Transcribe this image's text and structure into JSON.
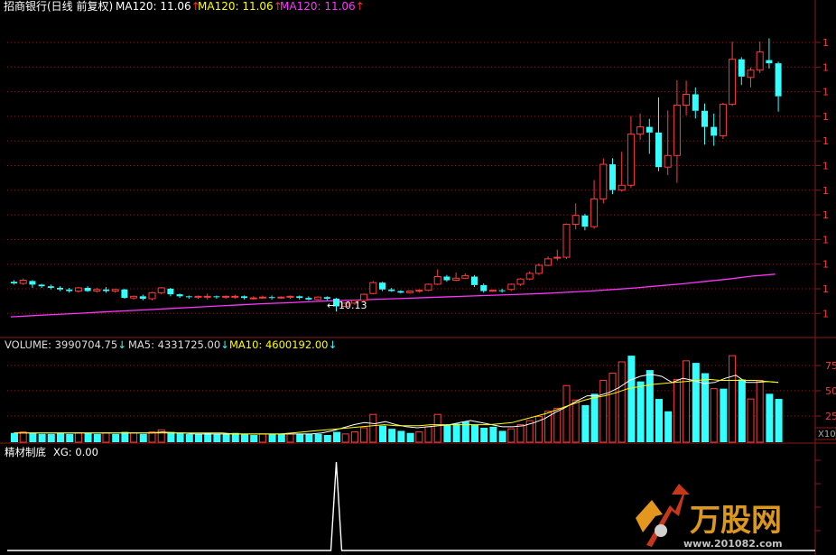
{
  "header": {
    "title": "招商银行(日线 前复权)",
    "ma_items": [
      {
        "text": "MA120: 11.06",
        "arrow": "↑",
        "color": "#ffffff",
        "arrow_color": "#ff3333"
      },
      {
        "text": "MA120: 11.06",
        "arrow": "↑",
        "color": "#ffff00",
        "arrow_color": "#ff3333"
      },
      {
        "text": "MA120: 11.06",
        "arrow": "↑",
        "color": "#ff33ff",
        "arrow_color": "#ff3333"
      }
    ]
  },
  "volume_header": {
    "items": [
      {
        "text": "VOLUME: 3990704.75",
        "arrow": "↓",
        "color": "#dddddd",
        "arrow_color": "#33ffff"
      },
      {
        "text": "MA5: 4331725.00",
        "arrow": "↓",
        "color": "#dddddd",
        "arrow_color": "#33ffff"
      },
      {
        "text": "MA10: 4600192.00",
        "arrow": "↓",
        "color": "#ffff00",
        "arrow_color": "#33ffff"
      }
    ]
  },
  "indicator_header": {
    "name": "精材制底",
    "value": "XG: 0.00"
  },
  "volume_axis": {
    "ticks": [
      "75",
      "50",
      "25"
    ],
    "unit": "X10"
  },
  "watermark": {
    "brand": "万股网",
    "url": "www.201082.com"
  },
  "colors": {
    "up": "#ff3b3b",
    "down": "#33ffff",
    "ma_line": "#ff33ff",
    "vol_ma5": "#ffffff",
    "vol_ma10": "#ffff00",
    "grid": "#8b1a1a",
    "signal": "#ffffff"
  },
  "chart_data": [
    {
      "type": "candlestick",
      "title": "招商银行(日线 前复权)",
      "low_marker": "10.13",
      "ylim": [
        9.8,
        17.2
      ],
      "candles": [
        [
          10.87,
          10.83,
          10.91,
          10.8
        ],
        [
          10.83,
          10.91,
          10.95,
          10.79
        ],
        [
          10.89,
          10.8,
          10.91,
          10.72
        ],
        [
          10.8,
          10.76,
          10.82,
          10.72
        ],
        [
          10.76,
          10.72,
          10.8,
          10.68
        ],
        [
          10.72,
          10.68,
          10.76,
          10.64
        ],
        [
          10.68,
          10.64,
          10.72,
          10.6
        ],
        [
          10.64,
          10.72,
          10.74,
          10.6
        ],
        [
          10.72,
          10.64,
          10.76,
          10.62
        ],
        [
          10.64,
          10.68,
          10.72,
          10.6
        ],
        [
          10.68,
          10.64,
          10.74,
          10.6
        ],
        [
          10.64,
          10.68,
          10.7,
          10.6
        ],
        [
          10.68,
          10.47,
          10.7,
          10.45
        ],
        [
          10.47,
          10.51,
          10.53,
          10.43
        ],
        [
          10.51,
          10.45,
          10.55,
          10.41
        ],
        [
          10.45,
          10.6,
          10.62,
          10.41
        ],
        [
          10.6,
          10.72,
          10.74,
          10.56
        ],
        [
          10.7,
          10.56,
          10.72,
          10.51
        ],
        [
          10.56,
          10.51,
          10.58,
          10.47
        ],
        [
          10.51,
          10.49,
          10.53,
          10.45
        ],
        [
          10.49,
          10.51,
          10.53,
          10.45
        ],
        [
          10.51,
          10.51,
          10.58,
          10.43
        ],
        [
          10.51,
          10.49,
          10.53,
          10.45
        ],
        [
          10.49,
          10.51,
          10.53,
          10.45
        ],
        [
          10.51,
          10.51,
          10.55,
          10.45
        ],
        [
          10.51,
          10.47,
          10.53,
          10.43
        ],
        [
          10.47,
          10.47,
          10.51,
          10.43
        ],
        [
          10.47,
          10.49,
          10.53,
          10.45
        ],
        [
          10.49,
          10.47,
          10.53,
          10.43
        ],
        [
          10.47,
          10.49,
          10.51,
          10.45
        ],
        [
          10.49,
          10.51,
          10.53,
          10.45
        ],
        [
          10.51,
          10.47,
          10.53,
          10.43
        ],
        [
          10.47,
          10.43,
          10.51,
          10.41
        ],
        [
          10.43,
          10.49,
          10.51,
          10.41
        ],
        [
          10.49,
          10.45,
          10.51,
          10.41
        ],
        [
          10.45,
          10.26,
          10.47,
          10.13
        ],
        [
          10.26,
          10.34,
          10.36,
          10.24
        ],
        [
          10.34,
          10.41,
          10.43,
          10.3
        ],
        [
          10.41,
          10.56,
          10.58,
          10.38
        ],
        [
          10.58,
          10.85,
          10.89,
          10.56
        ],
        [
          10.85,
          10.68,
          10.87,
          10.64
        ],
        [
          10.68,
          10.64,
          10.72,
          10.62
        ],
        [
          10.64,
          10.6,
          10.66,
          10.58
        ],
        [
          10.6,
          10.64,
          10.66,
          10.58
        ],
        [
          10.64,
          10.66,
          10.68,
          10.6
        ],
        [
          10.66,
          10.81,
          10.83,
          10.64
        ],
        [
          10.81,
          11.0,
          11.18,
          10.79
        ],
        [
          11.0,
          10.91,
          11.04,
          10.87
        ],
        [
          10.91,
          10.96,
          11.1,
          10.89
        ],
        [
          10.96,
          11.02,
          11.08,
          10.94
        ],
        [
          11.0,
          10.79,
          11.04,
          10.74
        ],
        [
          10.79,
          10.64,
          10.83,
          10.6
        ],
        [
          10.64,
          10.66,
          10.68,
          10.62
        ],
        [
          10.66,
          10.64,
          10.7,
          10.6
        ],
        [
          10.68,
          10.81,
          10.83,
          10.64
        ],
        [
          10.81,
          10.94,
          10.96,
          10.77
        ],
        [
          10.94,
          11.08,
          11.13,
          10.91
        ],
        [
          11.08,
          11.28,
          11.33,
          11.04
        ],
        [
          11.28,
          11.44,
          11.5,
          11.26
        ],
        [
          11.48,
          11.48,
          11.67,
          11.4
        ],
        [
          11.48,
          12.3,
          12.32,
          11.44
        ],
        [
          12.3,
          12.52,
          12.82,
          12.17
        ],
        [
          12.52,
          12.24,
          12.56,
          12.15
        ],
        [
          12.24,
          12.93,
          13.4,
          12.19
        ],
        [
          12.93,
          13.79,
          13.94,
          12.82
        ],
        [
          13.79,
          13.15,
          13.94,
          13.05
        ],
        [
          13.15,
          13.27,
          14.1,
          13.11
        ],
        [
          13.27,
          14.54,
          14.99,
          13.2
        ],
        [
          14.54,
          14.72,
          15.05,
          14.4
        ],
        [
          14.72,
          14.58,
          14.92,
          14.05
        ],
        [
          14.58,
          13.72,
          15.45,
          13.62
        ],
        [
          13.72,
          14.01,
          15.13,
          13.52
        ],
        [
          14.01,
          15.26,
          15.88,
          13.33
        ],
        [
          15.26,
          15.53,
          15.87,
          15.01
        ],
        [
          15.53,
          15.12,
          15.7,
          14.93
        ],
        [
          15.12,
          14.72,
          15.3,
          14.28
        ],
        [
          14.72,
          14.5,
          15.05,
          14.25
        ],
        [
          14.5,
          15.28,
          15.32,
          14.42
        ],
        [
          15.28,
          16.4,
          16.84,
          15.24
        ],
        [
          16.4,
          15.97,
          16.45,
          15.76
        ],
        [
          15.95,
          16.13,
          16.2,
          15.7
        ],
        [
          16.13,
          16.58,
          16.84,
          16.06
        ],
        [
          16.38,
          16.3,
          16.92,
          16.17
        ],
        [
          16.3,
          15.48,
          16.34,
          15.1
        ]
      ],
      "ma120": [
        10.0,
        10.03,
        10.06,
        10.09,
        10.12,
        10.15,
        10.18,
        10.21,
        10.24,
        10.27,
        10.3,
        10.33,
        10.35,
        10.38,
        10.4,
        10.42,
        10.44,
        10.46,
        10.48,
        10.5,
        10.52,
        10.54,
        10.56,
        10.58,
        10.61,
        10.64,
        10.68,
        10.72,
        10.77,
        10.82,
        10.88,
        10.94,
        11.01,
        11.06
      ]
    },
    {
      "type": "bar",
      "title": "VOLUME",
      "unit": "X10",
      "ylim": [
        0,
        85
      ],
      "values": [
        [
          9,
          1
        ],
        [
          10,
          0
        ],
        [
          9,
          1
        ],
        [
          8,
          1
        ],
        [
          8,
          1
        ],
        [
          9,
          1
        ],
        [
          8,
          1
        ],
        [
          9,
          0
        ],
        [
          9,
          1
        ],
        [
          8,
          1
        ],
        [
          9,
          0
        ],
        [
          8,
          1
        ],
        [
          10,
          1
        ],
        [
          9,
          0
        ],
        [
          8,
          1
        ],
        [
          10,
          0
        ],
        [
          12,
          0
        ],
        [
          10,
          1
        ],
        [
          9,
          1
        ],
        [
          8,
          1
        ],
        [
          8,
          1
        ],
        [
          9,
          1
        ],
        [
          8,
          1
        ],
        [
          8,
          1
        ],
        [
          9,
          1
        ],
        [
          8,
          1
        ],
        [
          7,
          1
        ],
        [
          8,
          0
        ],
        [
          8,
          1
        ],
        [
          8,
          1
        ],
        [
          8,
          0
        ],
        [
          8,
          1
        ],
        [
          8,
          1
        ],
        [
          8,
          1
        ],
        [
          7,
          1
        ],
        [
          10,
          1
        ],
        [
          8,
          0
        ],
        [
          10,
          0
        ],
        [
          14,
          0
        ],
        [
          27,
          0
        ],
        [
          16,
          1
        ],
        [
          13,
          1
        ],
        [
          11,
          1
        ],
        [
          9,
          1
        ],
        [
          10,
          0
        ],
        [
          15,
          0
        ],
        [
          27,
          0
        ],
        [
          17,
          1
        ],
        [
          18,
          1
        ],
        [
          20,
          1
        ],
        [
          17,
          1
        ],
        [
          14,
          1
        ],
        [
          15,
          1
        ],
        [
          11,
          1
        ],
        [
          13,
          0
        ],
        [
          17,
          0
        ],
        [
          21,
          0
        ],
        [
          25,
          0
        ],
        [
          30,
          0
        ],
        [
          33,
          0
        ],
        [
          55,
          0
        ],
        [
          41,
          0
        ],
        [
          36,
          1
        ],
        [
          47,
          1
        ],
        [
          60,
          0
        ],
        [
          67,
          0
        ],
        [
          78,
          0
        ],
        [
          84,
          1
        ],
        [
          59,
          1
        ],
        [
          70,
          1
        ],
        [
          42,
          1
        ],
        [
          30,
          1
        ],
        [
          61,
          0
        ],
        [
          79,
          0
        ],
        [
          77,
          1
        ],
        [
          67,
          1
        ],
        [
          52,
          0
        ],
        [
          52,
          1
        ],
        [
          84,
          0
        ],
        [
          61,
          1
        ],
        [
          42,
          0
        ],
        [
          60,
          0
        ],
        [
          47,
          1
        ],
        [
          42,
          1
        ]
      ],
      "ma5": [
        9,
        9,
        9,
        9,
        9,
        9,
        9,
        9,
        9,
        9,
        9,
        9,
        9,
        9,
        10,
        9,
        9,
        8,
        8,
        8,
        8,
        8,
        8,
        8,
        8,
        8,
        8,
        8,
        8,
        9,
        11,
        14,
        17,
        19,
        18,
        20,
        17,
        15,
        14,
        15,
        16,
        17,
        19,
        21,
        19,
        17,
        15,
        15,
        16,
        19,
        23,
        29,
        34,
        40,
        45,
        45,
        48,
        53,
        60,
        64,
        66,
        64,
        58,
        62,
        60,
        57,
        58,
        62,
        65,
        58,
        58,
        59,
        58
      ],
      "ma10": [
        9,
        9,
        9,
        9,
        9,
        9,
        9,
        9,
        9,
        9,
        9,
        9,
        9,
        9,
        9,
        9,
        9,
        9,
        9,
        8,
        8,
        8,
        8,
        8,
        9,
        10,
        11,
        12,
        13,
        14,
        15,
        16,
        17,
        16,
        16,
        16,
        17,
        17,
        17,
        17,
        17,
        17,
        18,
        19,
        22,
        25,
        28,
        32,
        36,
        40,
        43,
        45,
        48,
        52,
        54,
        56,
        57,
        58,
        59,
        60,
        61,
        60,
        60,
        60,
        60,
        59,
        58
      ]
    },
    {
      "type": "line",
      "title": "精材制底",
      "series_label": "XG",
      "ylim": [
        0,
        1
      ],
      "signal_index": 35,
      "values_note": "XG"
    }
  ]
}
